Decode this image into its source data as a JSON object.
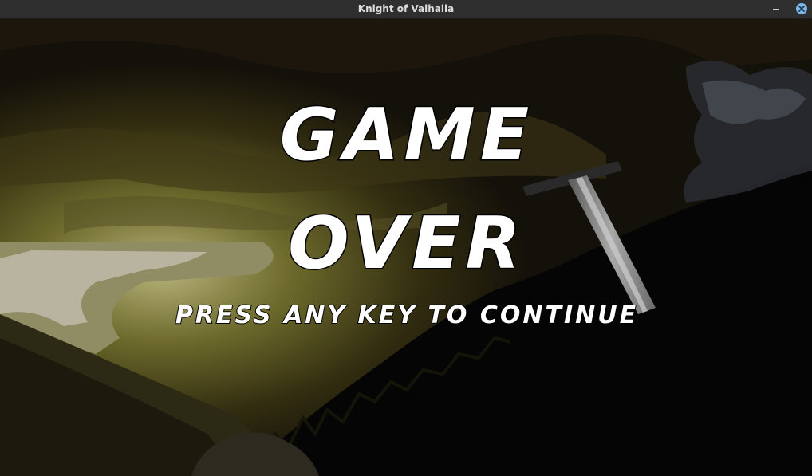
{
  "window": {
    "title": "Knight of Valhalla"
  },
  "game": {
    "headline_line1": "GAME",
    "headline_line2": "OVER",
    "prompt": "PRESS ANY KEY TO CONTINUE"
  },
  "icons": {
    "minimize": "minimize-icon",
    "close": "close-icon"
  },
  "colors": {
    "titlebar": "#2f2f2f",
    "close_button": "#7eb6e6",
    "text": "#ffffff"
  }
}
